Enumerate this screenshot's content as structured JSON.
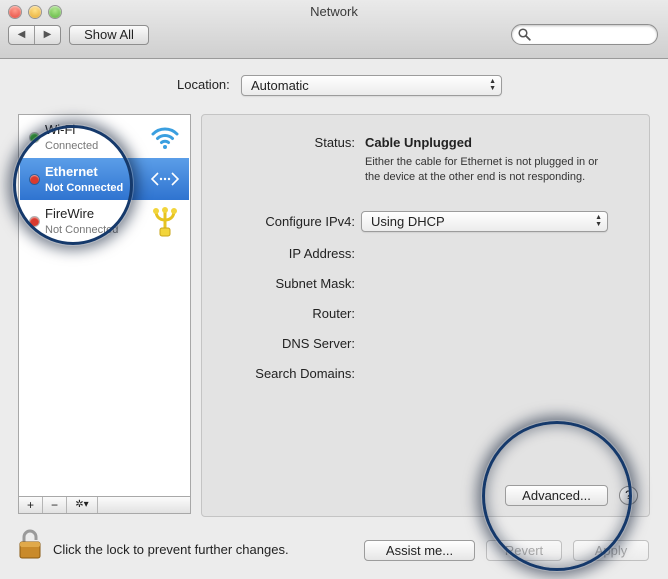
{
  "window": {
    "title": "Network",
    "back_arrow": "◀",
    "forward_arrow": "▶",
    "show_all_label": "Show All",
    "search_placeholder": ""
  },
  "location": {
    "label": "Location:",
    "value": "Automatic"
  },
  "services": [
    {
      "name": "Wi-Fi",
      "status": "Connected",
      "status_color": "#3fb33a",
      "icon": "wifi-icon",
      "selected": false
    },
    {
      "name": "Ethernet",
      "status": "Not Connected",
      "status_color": "#d93a2e",
      "icon": "ethernet-icon",
      "selected": true
    },
    {
      "name": "FireWire",
      "status": "Not Connected",
      "status_color": "#d93a2e",
      "icon": "firewire-icon",
      "selected": false
    }
  ],
  "sidebar_toolbar": {
    "add": "+",
    "remove": "−",
    "gear": "✲▾"
  },
  "detail": {
    "status_label": "Status:",
    "status_value": "Cable Unplugged",
    "status_description": "Either the cable for Ethernet is not plugged in or the device at the other end is not responding.",
    "configure_label": "Configure IPv4:",
    "configure_value": "Using DHCP",
    "ip_label": "IP Address:",
    "subnet_label": "Subnet Mask:",
    "router_label": "Router:",
    "dns_label": "DNS Server:",
    "search_domains_label": "Search Domains:",
    "advanced_label": "Advanced...",
    "help_label": "?"
  },
  "footer": {
    "lock_text": "Click the lock to prevent further changes.",
    "assist_label": "Assist me...",
    "revert_label": "Revert",
    "apply_label": "Apply"
  },
  "colors": {
    "selection": "#3a80d8",
    "ring": "#15396b"
  }
}
